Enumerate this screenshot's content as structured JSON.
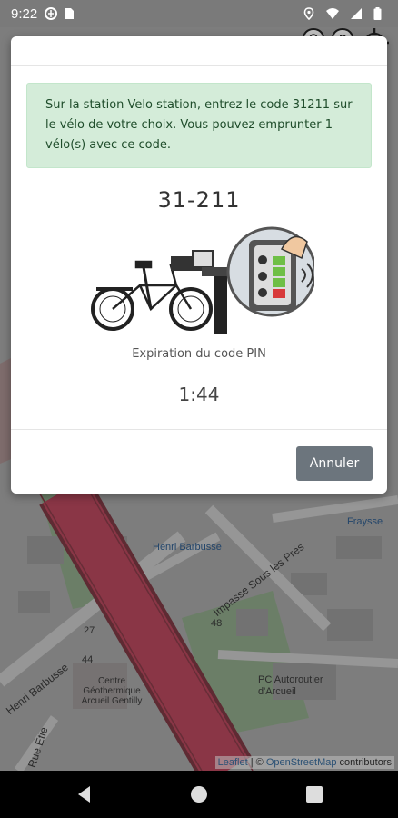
{
  "status_bar": {
    "time": "9:22",
    "icons": [
      "data-saver-icon",
      "sim-icon",
      "location-icon",
      "wifi-icon",
      "signal-icon",
      "battery-icon"
    ]
  },
  "map": {
    "labels": {
      "henri_barbusse_stop": "Henri Barbusse",
      "impasse": "Impasse Sous les Prés",
      "fraysse": "Fraysse",
      "henri_barbusse_street": "Henri Barbusse",
      "rue_etienne": "Rue Étie",
      "centre": "Centre Géothermique Arcueil Gentilly",
      "pc": "PC Autoroutier d'Arcueil",
      "num_27": "27",
      "num_48": "48",
      "num_44": "44"
    },
    "attribution": {
      "leaflet": "Leaflet",
      "separator": " | © ",
      "osm": "OpenStreetMap",
      "contributors": " contributors"
    },
    "controls": [
      "bike-marker-icon",
      "parking-marker-icon",
      "locate-icon"
    ]
  },
  "modal": {
    "message": "Sur la station Velo station, entrez le code 31211 sur le vélo de votre choix. Vous pouvez emprunter 1 vélo(s) avec ce code.",
    "code": "31-211",
    "expiration_label": "Expiration du code PIN",
    "timer": "1:44",
    "cancel_label": "Annuler"
  },
  "colors": {
    "alert_bg": "#d4ecd9",
    "button_bg": "#6c757d",
    "road_red": "#b9485e"
  }
}
